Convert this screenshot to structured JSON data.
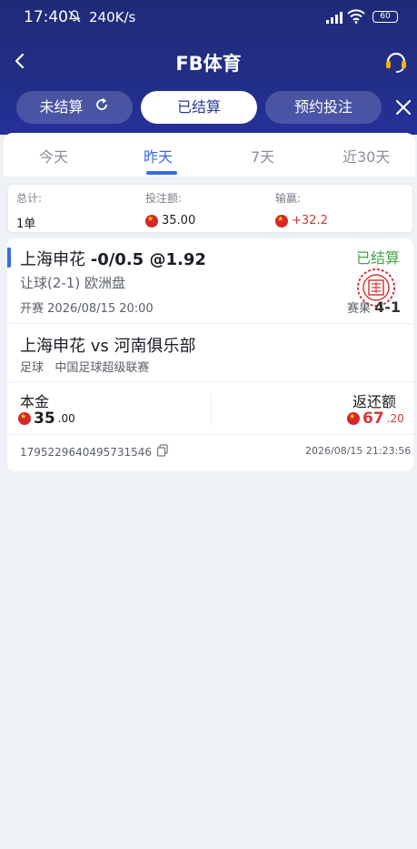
{
  "status_bar": {
    "time": "17:40",
    "speed": "240K/s",
    "battery": "60"
  },
  "header": {
    "title": "FB体育"
  },
  "bet_tabs": [
    {
      "label": "未结算"
    },
    {
      "label": "已结算"
    },
    {
      "label": "预约投注"
    }
  ],
  "date_tabs": [
    {
      "label": "今天"
    },
    {
      "label": "昨天"
    },
    {
      "label": "7天"
    },
    {
      "label": "近30天"
    }
  ],
  "summary": {
    "total_label": "总计:",
    "total_value": "1单",
    "stake_label": "投注额:",
    "stake_value": "35.00",
    "winnings_label": "输赢:",
    "winnings_value": "+32.2"
  },
  "bet": {
    "team": "上海申花",
    "handicap_odds": "-0/0.5 @1.92",
    "status": "已结算",
    "market": "让球(2-1) 欧洲盘",
    "kickoff_label": "开赛",
    "kickoff_time": "2026/08/15 20:00",
    "result_label": "赛果",
    "result_score": "4-1",
    "match": "上海申花 vs 河南俱乐部",
    "sport": "足球",
    "league": "中国足球超级联赛",
    "stake_label": "本金",
    "stake_int": "35",
    "stake_dec": ".00",
    "return_label": "返还额",
    "return_int": "67",
    "return_dec": ".20",
    "order_id": "1795229640495731546",
    "settle_time": "2026/08/15 21:23:56"
  },
  "colors": {
    "header_bg": "#1f2a78",
    "accent_blue": "#3a68e8",
    "win_red": "#d23a3a",
    "settled_green": "#45a449"
  },
  "icons": [
    "bell-off-icon",
    "signal-icon",
    "wifi-icon",
    "back-icon",
    "headset-icon",
    "refresh-icon",
    "close-icon",
    "cny-flag-icon",
    "copy-icon",
    "settled-stamp-icon"
  ]
}
